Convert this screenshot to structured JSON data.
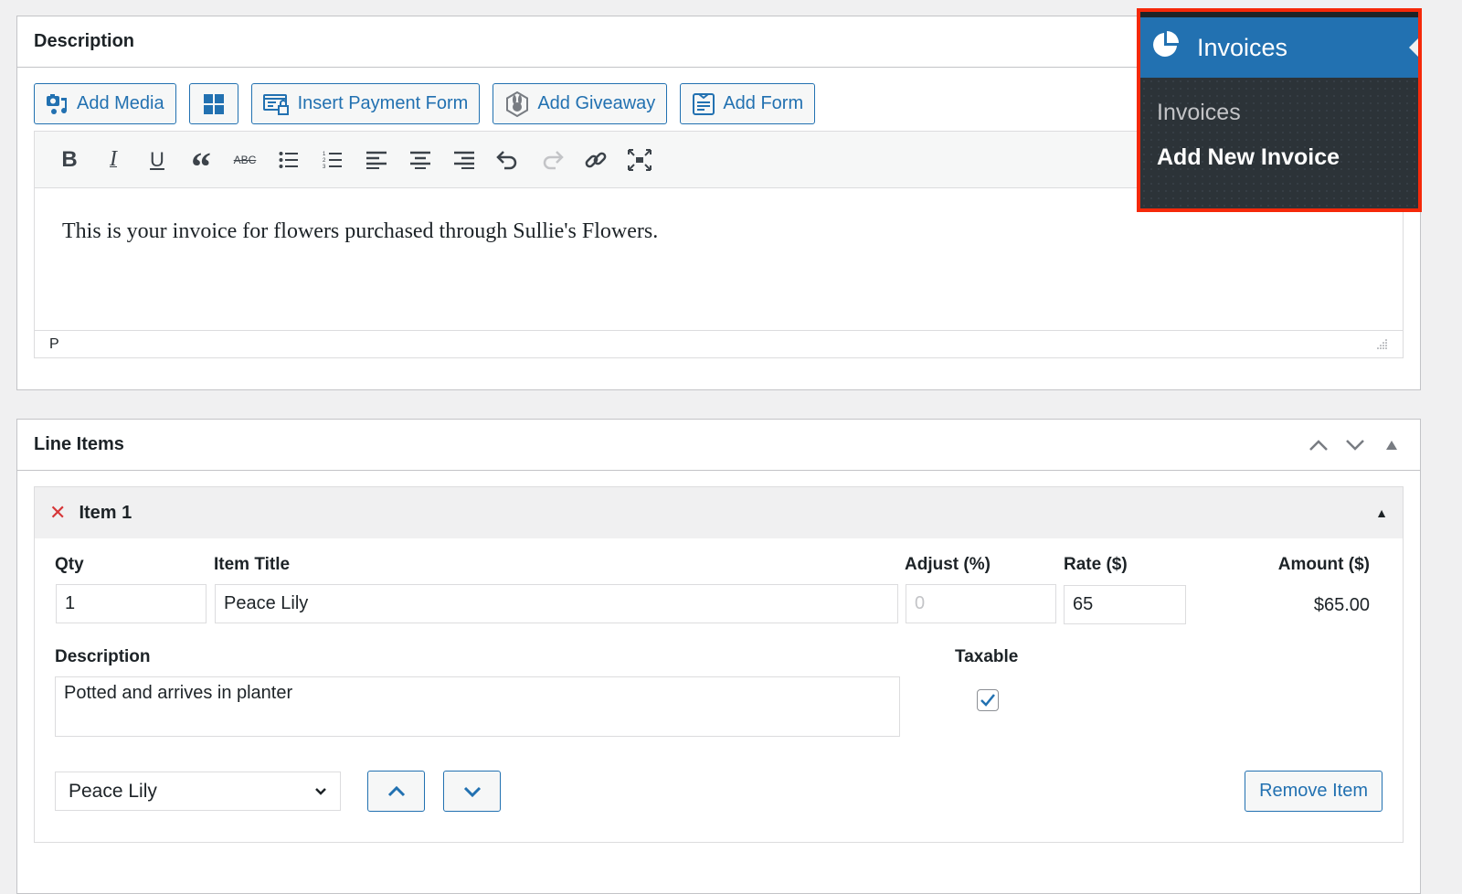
{
  "description_box": {
    "title": "Description",
    "media_buttons": [
      {
        "label": "Add Media",
        "icon": "add-media-icon"
      },
      {
        "label": "",
        "icon": "blocks-grid-icon"
      },
      {
        "label": "Insert Payment Form",
        "icon": "payment-form-icon"
      },
      {
        "label": "Add Giveaway",
        "icon": "giveaway-rabbit-icon"
      },
      {
        "label": "Add Form",
        "icon": "form-icon"
      }
    ],
    "toolbar": [
      "bold",
      "italic",
      "underline",
      "blockquote",
      "strikethrough",
      "bulleted-list",
      "numbered-list",
      "align-left",
      "align-center",
      "align-right",
      "undo",
      "redo",
      "link",
      "fullscreen"
    ],
    "content": "This is your invoice for flowers purchased through Sullie's Flowers.",
    "status_path": "P"
  },
  "line_items_box": {
    "title": "Line Items",
    "items": [
      {
        "title": "Item 1",
        "labels": {
          "qty": "Qty",
          "item_title": "Item Title",
          "adjust": "Adjust (%)",
          "rate": "Rate ($)",
          "amount": "Amount ($)",
          "description": "Description",
          "taxable": "Taxable"
        },
        "qty": "1",
        "item_title": "Peace Lily",
        "adjust_placeholder": "0",
        "rate": "65",
        "amount": "$65.00",
        "description": "Potted and arrives in planter",
        "taxable": true,
        "product_select": "Peace Lily",
        "remove_label": "Remove Item"
      }
    ]
  },
  "admin_menu": {
    "header": "Invoices",
    "submenu": [
      {
        "label": "Invoices",
        "current": false
      },
      {
        "label": "Add New Invoice",
        "current": true
      }
    ],
    "highlight_color": "#f5290a",
    "accent_color": "#2271b1"
  }
}
